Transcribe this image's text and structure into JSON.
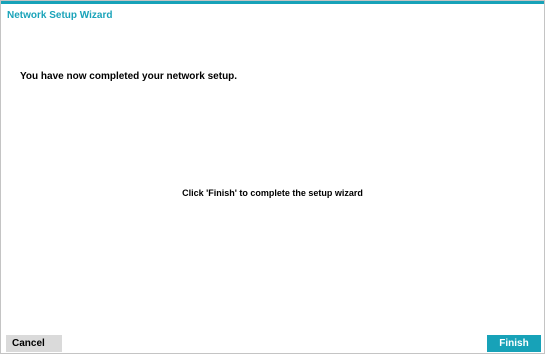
{
  "dialog": {
    "title": "Network Setup Wizard",
    "message": "You have now completed your network setup.",
    "instruction": "Click 'Finish' to complete the setup wizard"
  },
  "buttons": {
    "cancel_label": "Cancel",
    "finish_label": "Finish"
  },
  "colors": {
    "accent": "#17a2b8",
    "title_text": "#1aa3b9",
    "cancel_bg": "#dadada",
    "border": "#c4c4c4"
  }
}
